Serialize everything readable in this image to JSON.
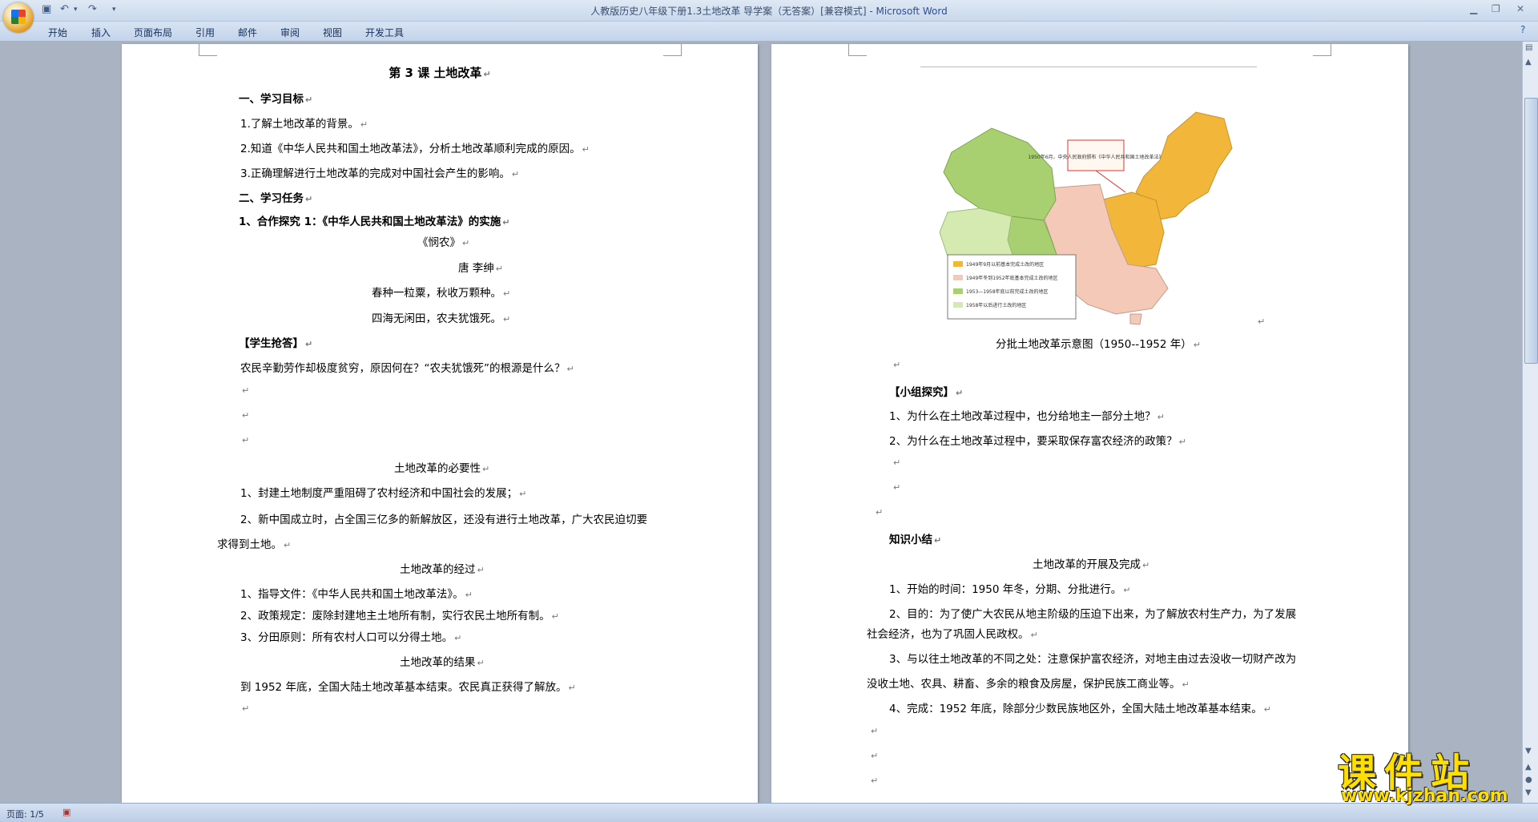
{
  "window": {
    "title": "人教版历史八年级下册1.3土地改革 导学案（无答案）[兼容模式]",
    "app_name": "Microsoft Word"
  },
  "ribbon_tabs": [
    "开始",
    "插入",
    "页面布局",
    "引用",
    "邮件",
    "审阅",
    "视图",
    "开发工具"
  ],
  "left_page": {
    "title": "第 3 课  土地改革",
    "heading1": "一、学习目标",
    "goals": [
      "1.了解土地改革的背景。",
      "2.知道《中华人民共和国土地改革法》，分析土地改革顺利完成的原因。",
      "3.正确理解进行土地改革的完成对中国社会产生的影响。"
    ],
    "heading2": "二、学习任务",
    "task1": "1、合作探究 1：《中华人民共和国土地改革法》的实施",
    "poem_title": "《悯农》",
    "poem_author": "唐  李绅",
    "poem_line1": "春种一粒粟，秋收万颗种。",
    "poem_line2": "四海无闲田，农夫犹饿死。",
    "answer_label": "【学生抢答】",
    "question": "农民辛勤劳作却极度贫穷，原因何在？“农夫犹饿死”的根源是什么？",
    "necessity_title": "土地改革的必要性",
    "necessity_1": "1、封建土地制度严重阻碍了农村经济和中国社会的发展；",
    "necessity_2a": "2、新中国成立时，占全国三亿多的新解放区，还没有进行土地改革，广大农民迫切要",
    "necessity_2b": "求得到土地。",
    "process_title": "土地改革的经过",
    "process_1": "1、指导文件：《中华人民共和国土地改革法》。",
    "process_2": "2、政策规定：废除封建地主土地所有制，实行农民土地所有制。",
    "process_3": "3、分田原则：所有农村人口可以分得土地。",
    "result_title": "土地改革的结果",
    "result_text": "到 1952 年底，全国大陆土地改革基本结束。农民真正获得了解放。"
  },
  "right_page": {
    "map_callout": "1950年6月，中央人民政府颁布《中华人民共和国土地改革法》",
    "map_legend": [
      "1949年9月以前基本完成土改的地区",
      "1949年冬到1952年底基本完成土改的地区",
      "1953—1958年底以前完成土改的地区",
      "1958年以后进行土改的地区"
    ],
    "map_caption": "分批土地改革示意图（1950--1952 年）",
    "group_label": "【小组探究】",
    "group_q1": "1、为什么在土地改革过程中，也分给地主一部分土地？",
    "group_q2": "2、为什么在土地改革过程中，要采取保存富农经济的政策？",
    "summary_label": "知识小结",
    "summary_title": "土地改革的开展及完成",
    "summary_1": "1、开始的时间：1950 年冬，分期、分批进行。",
    "summary_2a": "2、目的：为了使广大农民从地主阶级的压迫下出来，为了解放农村生产力，为了发展",
    "summary_2b": "社会经济，也为了巩固人民政权。",
    "summary_3a": "3、与以往土地改革的不同之处：注意保护富农经济，对地主由过去没收一切财产改为",
    "summary_3b": "没收土地、农具、耕畜、多余的粮食及房屋，保护民族工商业等。",
    "summary_4": "4、完成：1952 年底，除部分少数民族地区外，全国大陆土地改革基本结束。"
  },
  "statusbar": {
    "page": "页面: 1/5"
  },
  "watermark": {
    "title": "课件站",
    "url": "www.kjzhan.com"
  },
  "colors": {
    "map_orange": "#f2b63a",
    "map_pink": "#f4c9b8",
    "map_green": "#a8d070",
    "map_lightgreen": "#d4eab0"
  }
}
